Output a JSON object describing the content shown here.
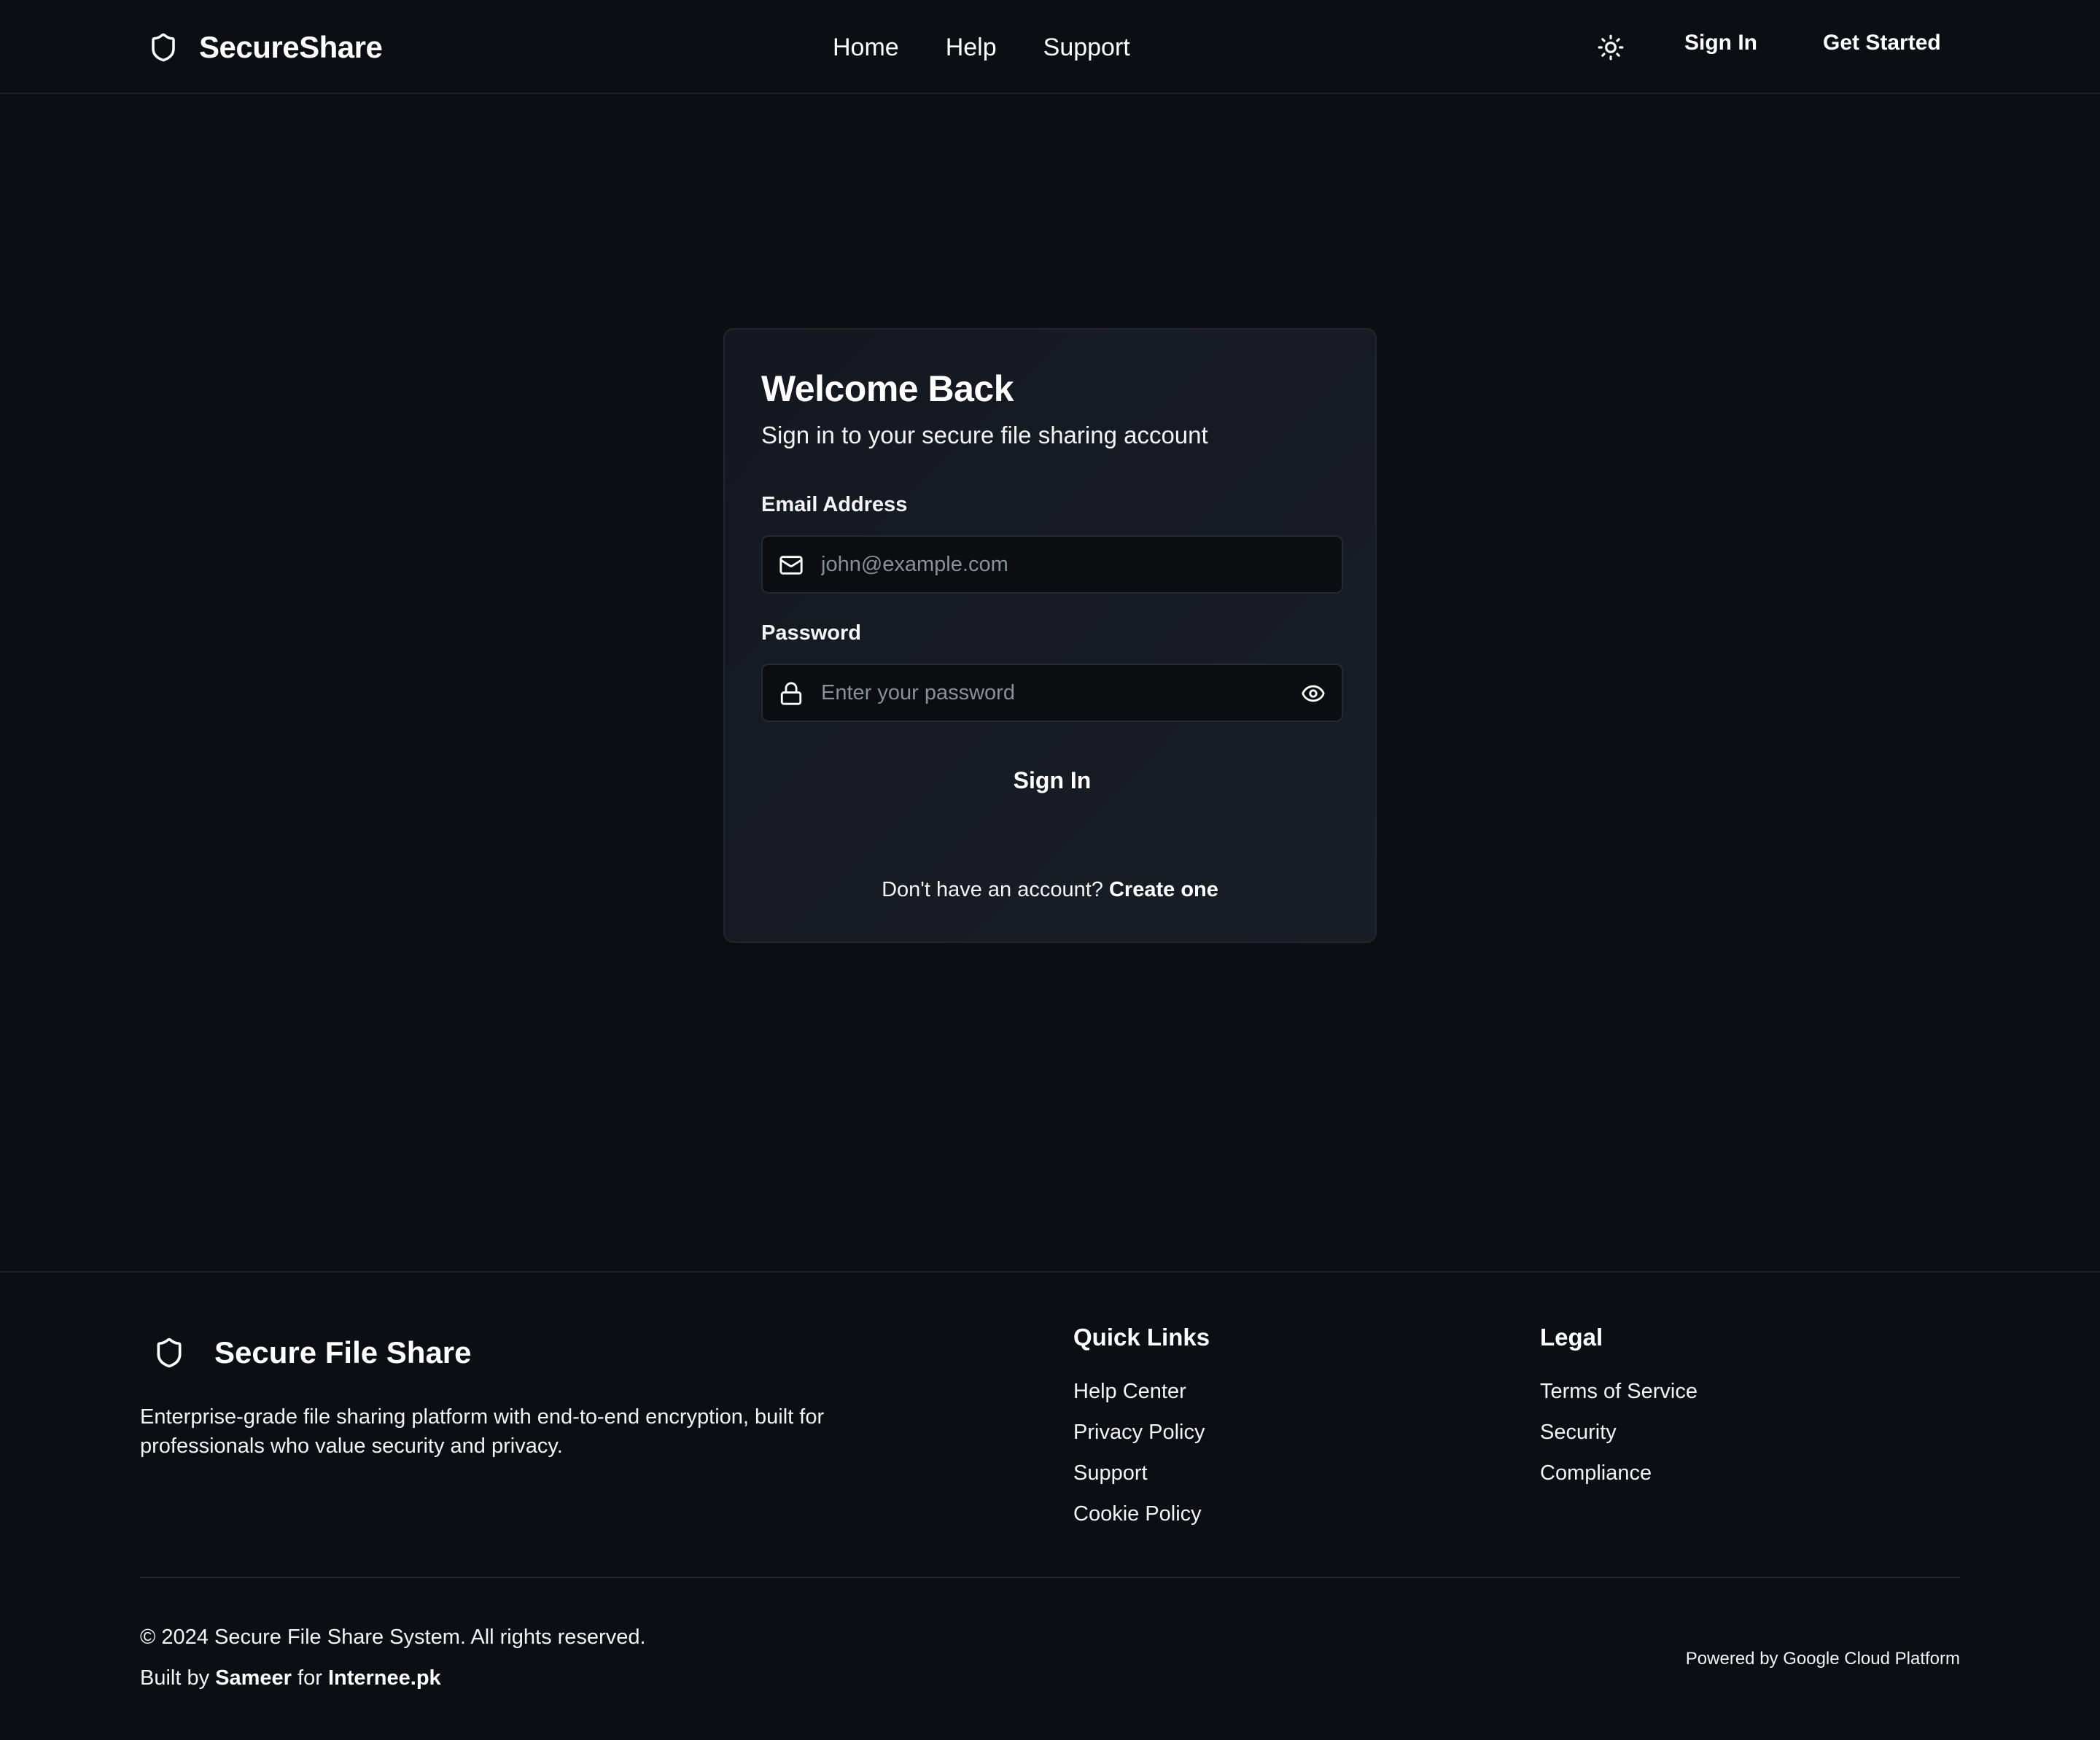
{
  "header": {
    "brand": "SecureShare",
    "nav": [
      "Home",
      "Help",
      "Support"
    ],
    "sign_in": "Sign In",
    "get_started": "Get Started"
  },
  "card": {
    "title": "Welcome Back",
    "subtitle": "Sign in to your secure file sharing account",
    "email_label": "Email Address",
    "email_placeholder": "john@example.com",
    "email_value": "",
    "password_label": "Password",
    "password_placeholder": "Enter your password",
    "password_value": "",
    "submit": "Sign In",
    "no_account": "Don't have an account?",
    "create_link": "Create one"
  },
  "footer": {
    "brand": "Secure File Share",
    "description": "Enterprise-grade file sharing platform with end-to-end encryption, built for professionals who value security and privacy.",
    "quick_links": {
      "heading": "Quick Links",
      "items": [
        "Help Center",
        "Privacy Policy",
        "Support",
        "Cookie Policy"
      ]
    },
    "legal": {
      "heading": "Legal",
      "items": [
        "Terms of Service",
        "Security",
        "Compliance"
      ]
    },
    "copyright": "© 2024 Secure File Share System. All rights reserved.",
    "built_prefix": "Built by",
    "built_author": "Sameer",
    "built_for": "for",
    "built_org": "Internee.pk",
    "powered_by": "Powered by Google Cloud Platform"
  },
  "icons": {
    "brand": "shield-icon",
    "theme_toggle": "sun-icon",
    "email_field": "mail-icon",
    "password_field": "lock-icon",
    "password_visibility": "eye-icon",
    "footer_brand": "shield-icon"
  },
  "colors": {
    "background": "#0c0e13",
    "card_background": "#171a22",
    "input_background": "#0b0d11",
    "border": "#22262f",
    "text": "#ffffff",
    "placeholder": "#8a8f99"
  }
}
